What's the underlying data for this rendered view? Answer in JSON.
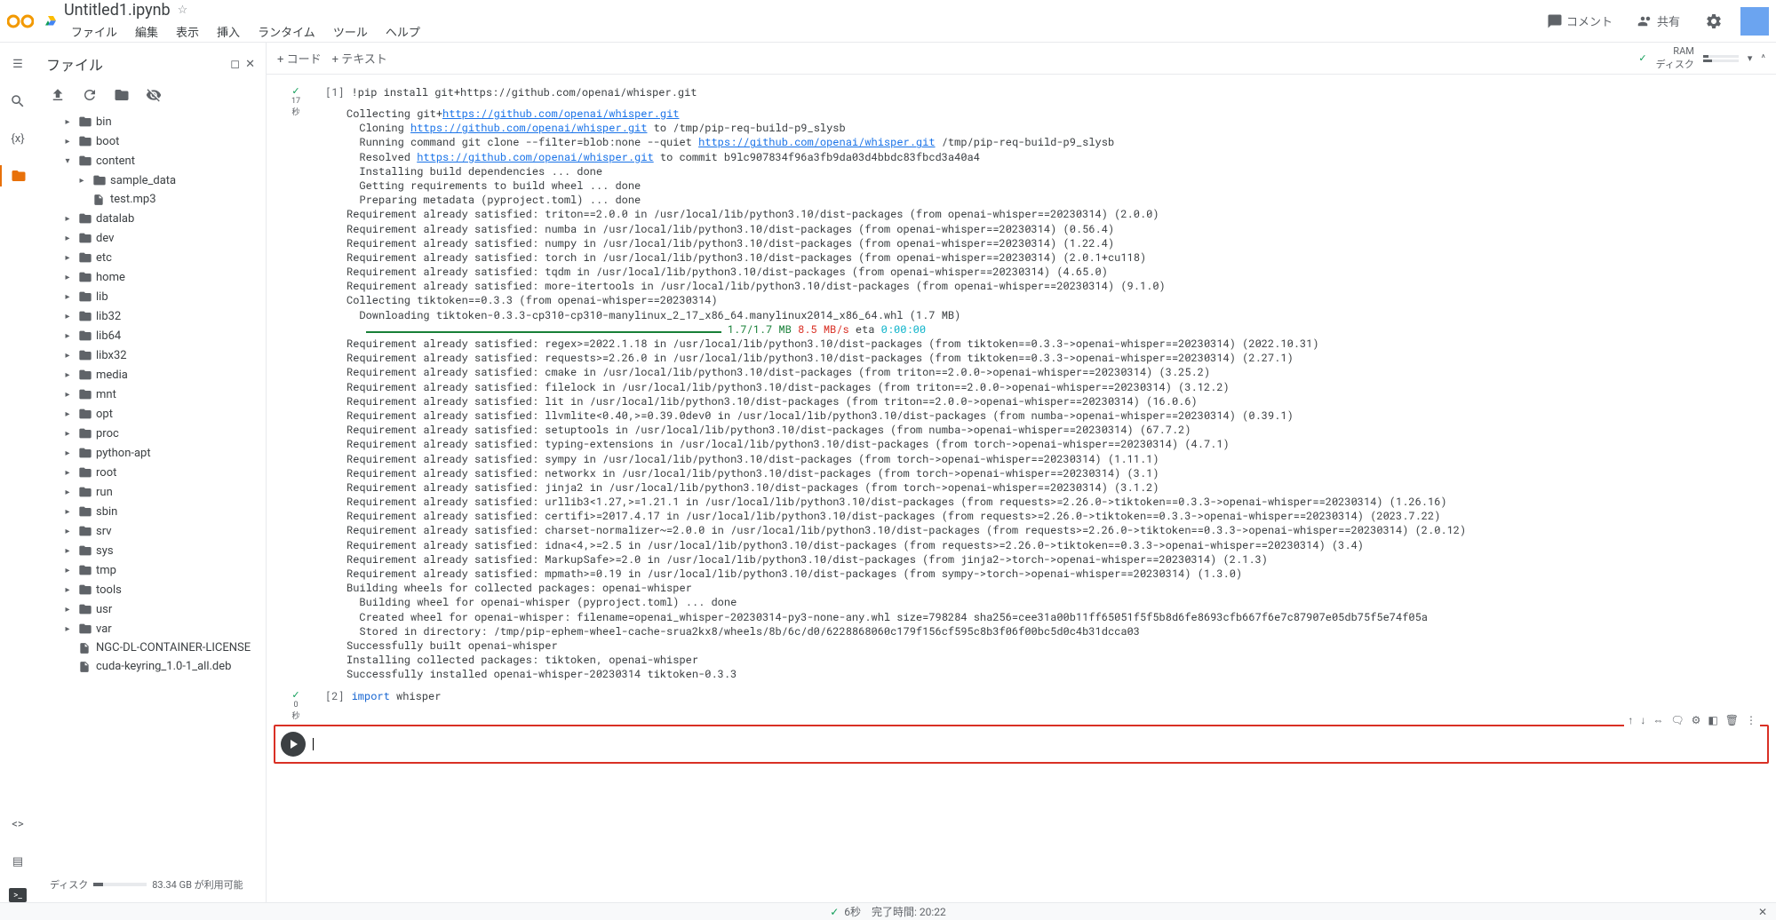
{
  "header": {
    "title": "Untitled1.ipynb",
    "menus": [
      "ファイル",
      "編集",
      "表示",
      "挿入",
      "ランタイム",
      "ツール",
      "ヘルプ"
    ],
    "comment": "コメント",
    "share": "共有"
  },
  "file_panel": {
    "title": "ファイル",
    "disk_label": "ディスク",
    "disk_free": "83.34 GB が利用可能"
  },
  "tree": [
    {
      "name": "bin",
      "type": "folder",
      "indent": 1,
      "exp": "▸"
    },
    {
      "name": "boot",
      "type": "folder",
      "indent": 1,
      "exp": "▸"
    },
    {
      "name": "content",
      "type": "folder",
      "indent": 1,
      "exp": "▾"
    },
    {
      "name": "sample_data",
      "type": "folder",
      "indent": 2,
      "exp": "▸"
    },
    {
      "name": "test.mp3",
      "type": "file",
      "indent": 2,
      "exp": ""
    },
    {
      "name": "datalab",
      "type": "folder",
      "indent": 1,
      "exp": "▸"
    },
    {
      "name": "dev",
      "type": "folder",
      "indent": 1,
      "exp": "▸"
    },
    {
      "name": "etc",
      "type": "folder",
      "indent": 1,
      "exp": "▸"
    },
    {
      "name": "home",
      "type": "folder",
      "indent": 1,
      "exp": "▸"
    },
    {
      "name": "lib",
      "type": "folder",
      "indent": 1,
      "exp": "▸"
    },
    {
      "name": "lib32",
      "type": "folder",
      "indent": 1,
      "exp": "▸"
    },
    {
      "name": "lib64",
      "type": "folder",
      "indent": 1,
      "exp": "▸"
    },
    {
      "name": "libx32",
      "type": "folder",
      "indent": 1,
      "exp": "▸"
    },
    {
      "name": "media",
      "type": "folder",
      "indent": 1,
      "exp": "▸"
    },
    {
      "name": "mnt",
      "type": "folder",
      "indent": 1,
      "exp": "▸"
    },
    {
      "name": "opt",
      "type": "folder",
      "indent": 1,
      "exp": "▸"
    },
    {
      "name": "proc",
      "type": "folder",
      "indent": 1,
      "exp": "▸"
    },
    {
      "name": "python-apt",
      "type": "folder",
      "indent": 1,
      "exp": "▸"
    },
    {
      "name": "root",
      "type": "folder",
      "indent": 1,
      "exp": "▸"
    },
    {
      "name": "run",
      "type": "folder",
      "indent": 1,
      "exp": "▸"
    },
    {
      "name": "sbin",
      "type": "folder",
      "indent": 1,
      "exp": "▸"
    },
    {
      "name": "srv",
      "type": "folder",
      "indent": 1,
      "exp": "▸"
    },
    {
      "name": "sys",
      "type": "folder",
      "indent": 1,
      "exp": "▸"
    },
    {
      "name": "tmp",
      "type": "folder",
      "indent": 1,
      "exp": "▸"
    },
    {
      "name": "tools",
      "type": "folder",
      "indent": 1,
      "exp": "▸"
    },
    {
      "name": "usr",
      "type": "folder",
      "indent": 1,
      "exp": "▸"
    },
    {
      "name": "var",
      "type": "folder",
      "indent": 1,
      "exp": "▸"
    },
    {
      "name": "NGC-DL-CONTAINER-LICENSE",
      "type": "file",
      "indent": 1,
      "exp": ""
    },
    {
      "name": "cuda-keyring_1.0-1_all.deb",
      "type": "file",
      "indent": 1,
      "exp": ""
    }
  ],
  "toolbar": {
    "code": "+ コード",
    "text": "+ テキスト",
    "ram": "RAM",
    "disk": "ディスク"
  },
  "cell1": {
    "num": "[1]",
    "time": "17\n秒",
    "code": "!pip install git+https://github.com/openai/whisper.git",
    "links": {
      "l1": "https://github.com/openai/whisper.git",
      "l2": "https://github.com/openai/whisper.git",
      "l3": "https://github.com/openai/whisper.git",
      "l4": "https://github.com/openai/whisper.git"
    },
    "out": {
      "p1": "Collecting git+",
      "p2": "  Cloning ",
      "p2b": " to /tmp/pip-req-build-p9_slysb",
      "p3": "  Running command git clone --filter=blob:none --quiet ",
      "p3b": " /tmp/pip-req-build-p9_slysb",
      "p4": "  Resolved ",
      "p4b": " to commit b9lc907834f96a3fb9da03d4bbdc83fbcd3a40a4",
      "p5": "  Installing build dependencies ... done",
      "p6": "  Getting requirements to build wheel ... done",
      "p7": "  Preparing metadata (pyproject.toml) ... done",
      "p8": "Requirement already satisfied: triton==2.0.0 in /usr/local/lib/python3.10/dist-packages (from openai-whisper==20230314) (2.0.0)",
      "p9": "Requirement already satisfied: numba in /usr/local/lib/python3.10/dist-packages (from openai-whisper==20230314) (0.56.4)",
      "p10": "Requirement already satisfied: numpy in /usr/local/lib/python3.10/dist-packages (from openai-whisper==20230314) (1.22.4)",
      "p11": "Requirement already satisfied: torch in /usr/local/lib/python3.10/dist-packages (from openai-whisper==20230314) (2.0.1+cu118)",
      "p12": "Requirement already satisfied: tqdm in /usr/local/lib/python3.10/dist-packages (from openai-whisper==20230314) (4.65.0)",
      "p13": "Requirement already satisfied: more-itertools in /usr/local/lib/python3.10/dist-packages (from openai-whisper==20230314) (9.1.0)",
      "p14": "Collecting tiktoken==0.3.3 (from openai-whisper==20230314)",
      "p15": "  Downloading tiktoken-0.3.3-cp310-cp310-manylinux_2_17_x86_64.manylinux2014_x86_64.whl (1.7 MB)",
      "pbar1": "                                                    ",
      "pbar2": " 1.7/1.7 MB",
      "pbar3": " 8.5 MB/s",
      "pbar4": " eta ",
      "pbar5": "0:00:00",
      "p16": "Requirement already satisfied: regex>=2022.1.18 in /usr/local/lib/python3.10/dist-packages (from tiktoken==0.3.3->openai-whisper==20230314) (2022.10.31)",
      "p17": "Requirement already satisfied: requests>=2.26.0 in /usr/local/lib/python3.10/dist-packages (from tiktoken==0.3.3->openai-whisper==20230314) (2.27.1)",
      "p18": "Requirement already satisfied: cmake in /usr/local/lib/python3.10/dist-packages (from triton==2.0.0->openai-whisper==20230314) (3.25.2)",
      "p19": "Requirement already satisfied: filelock in /usr/local/lib/python3.10/dist-packages (from triton==2.0.0->openai-whisper==20230314) (3.12.2)",
      "p20": "Requirement already satisfied: lit in /usr/local/lib/python3.10/dist-packages (from triton==2.0.0->openai-whisper==20230314) (16.0.6)",
      "p21": "Requirement already satisfied: llvmlite<0.40,>=0.39.0dev0 in /usr/local/lib/python3.10/dist-packages (from numba->openai-whisper==20230314) (0.39.1)",
      "p22": "Requirement already satisfied: setuptools in /usr/local/lib/python3.10/dist-packages (from numba->openai-whisper==20230314) (67.7.2)",
      "p23": "Requirement already satisfied: typing-extensions in /usr/local/lib/python3.10/dist-packages (from torch->openai-whisper==20230314) (4.7.1)",
      "p24": "Requirement already satisfied: sympy in /usr/local/lib/python3.10/dist-packages (from torch->openai-whisper==20230314) (1.11.1)",
      "p25": "Requirement already satisfied: networkx in /usr/local/lib/python3.10/dist-packages (from torch->openai-whisper==20230314) (3.1)",
      "p26": "Requirement already satisfied: jinja2 in /usr/local/lib/python3.10/dist-packages (from torch->openai-whisper==20230314) (3.1.2)",
      "p27": "Requirement already satisfied: urllib3<1.27,>=1.21.1 in /usr/local/lib/python3.10/dist-packages (from requests>=2.26.0->tiktoken==0.3.3->openai-whisper==20230314) (1.26.16)",
      "p28": "Requirement already satisfied: certifi>=2017.4.17 in /usr/local/lib/python3.10/dist-packages (from requests>=2.26.0->tiktoken==0.3.3->openai-whisper==20230314) (2023.7.22)",
      "p29": "Requirement already satisfied: charset-normalizer~=2.0.0 in /usr/local/lib/python3.10/dist-packages (from requests>=2.26.0->tiktoken==0.3.3->openai-whisper==20230314) (2.0.12)",
      "p30": "Requirement already satisfied: idna<4,>=2.5 in /usr/local/lib/python3.10/dist-packages (from requests>=2.26.0->tiktoken==0.3.3->openai-whisper==20230314) (3.4)",
      "p31": "Requirement already satisfied: MarkupSafe>=2.0 in /usr/local/lib/python3.10/dist-packages (from jinja2->torch->openai-whisper==20230314) (2.1.3)",
      "p32": "Requirement already satisfied: mpmath>=0.19 in /usr/local/lib/python3.10/dist-packages (from sympy->torch->openai-whisper==20230314) (1.3.0)",
      "p33": "Building wheels for collected packages: openai-whisper",
      "p34": "  Building wheel for openai-whisper (pyproject.toml) ... done",
      "p35": "  Created wheel for openai-whisper: filename=openai_whisper-20230314-py3-none-any.whl size=798284 sha256=cee31a00b11ff65051f5f5b8d6fe8693cfb667f6e7c87907e05db75f5e74f05a",
      "p36": "  Stored in directory: /tmp/pip-ephem-wheel-cache-srua2kx8/wheels/8b/6c/d0/6228868060c179f156cf595c8b3f06f00bc5d0c4b31dcca03",
      "p37": "Successfully built openai-whisper",
      "p38": "Installing collected packages: tiktoken, openai-whisper",
      "p39": "Successfully installed openai-whisper-20230314 tiktoken-0.3.3"
    }
  },
  "cell2": {
    "num": "[2]",
    "time": "0\n秒",
    "code_kw": "import",
    "code_rest": " whisper"
  },
  "status": {
    "text": "6秒　完了時間: 20:22"
  }
}
